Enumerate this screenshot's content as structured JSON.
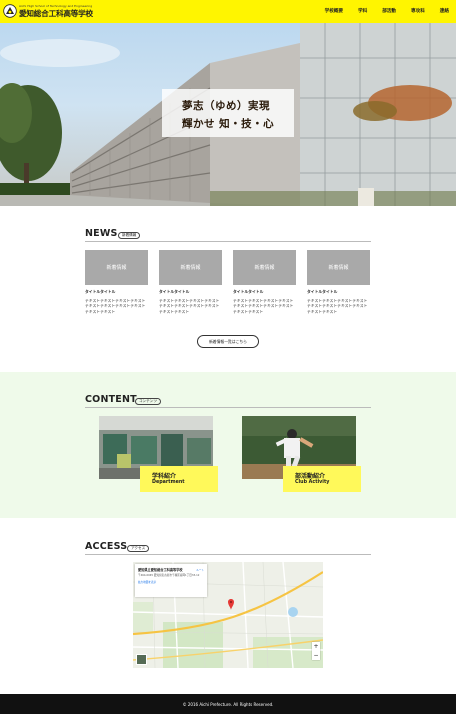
{
  "header": {
    "logo_en": "Aichi High School of Technology and Engineering",
    "logo_jp": "愛知総合工科高等学校",
    "nav": [
      "学校概要",
      "学科",
      "部活動",
      "専攻科",
      "連絡"
    ]
  },
  "hero": {
    "line1": "夢志（ゆめ）実現",
    "line2": "輝かせ 知・技・心"
  },
  "news": {
    "title": "NEWS",
    "badge": "新着情報",
    "cards": [
      {
        "thumb": "新着情報",
        "title": "タイトルタイトル",
        "text": "テキストテキストテキストテキストテキストテキストテキストテキストテキストテキスト"
      },
      {
        "thumb": "新着情報",
        "title": "タイトルタイトル",
        "text": "テキストテキストテキストテキストテキストテキストテキストテキストテキストテキスト"
      },
      {
        "thumb": "新着情報",
        "title": "タイトルタイトル",
        "text": "テキストテキストテキストテキストテキストテキストテキストテキストテキストテキスト"
      },
      {
        "thumb": "新着情報",
        "title": "タイトルタイトル",
        "text": "テキストテキストテキストテキストテキストテキストテキストテキストテキストテキスト"
      }
    ],
    "more": "新着情報一覧はこちら"
  },
  "content": {
    "title": "CONTENT",
    "badge": "コンテンツ",
    "cards": [
      {
        "jp": "学科紹介",
        "en": "Department"
      },
      {
        "jp": "部活動紹介",
        "en": "Club Activity"
      }
    ]
  },
  "access": {
    "title": "ACCESS",
    "badge": "アクセス",
    "map": {
      "name": "愛知県立愛知総合工科高等学校",
      "address": "〒464-0045 愛知県名古屋市千種区春岡1丁目33-12",
      "link": "拡大地図を表示",
      "route": "ルート"
    }
  },
  "footer": {
    "copyright": "© 2016 Aichi Prefecture. All Rights Reserved."
  },
  "colors": {
    "accent_yellow": "#fff500",
    "content_bg": "#effaea",
    "footer_bg": "#111111",
    "map_pin": "#e53935"
  },
  "icons": {
    "zoom_in": "plus-icon",
    "zoom_out": "minus-icon",
    "logo": "school-emblem-icon"
  }
}
